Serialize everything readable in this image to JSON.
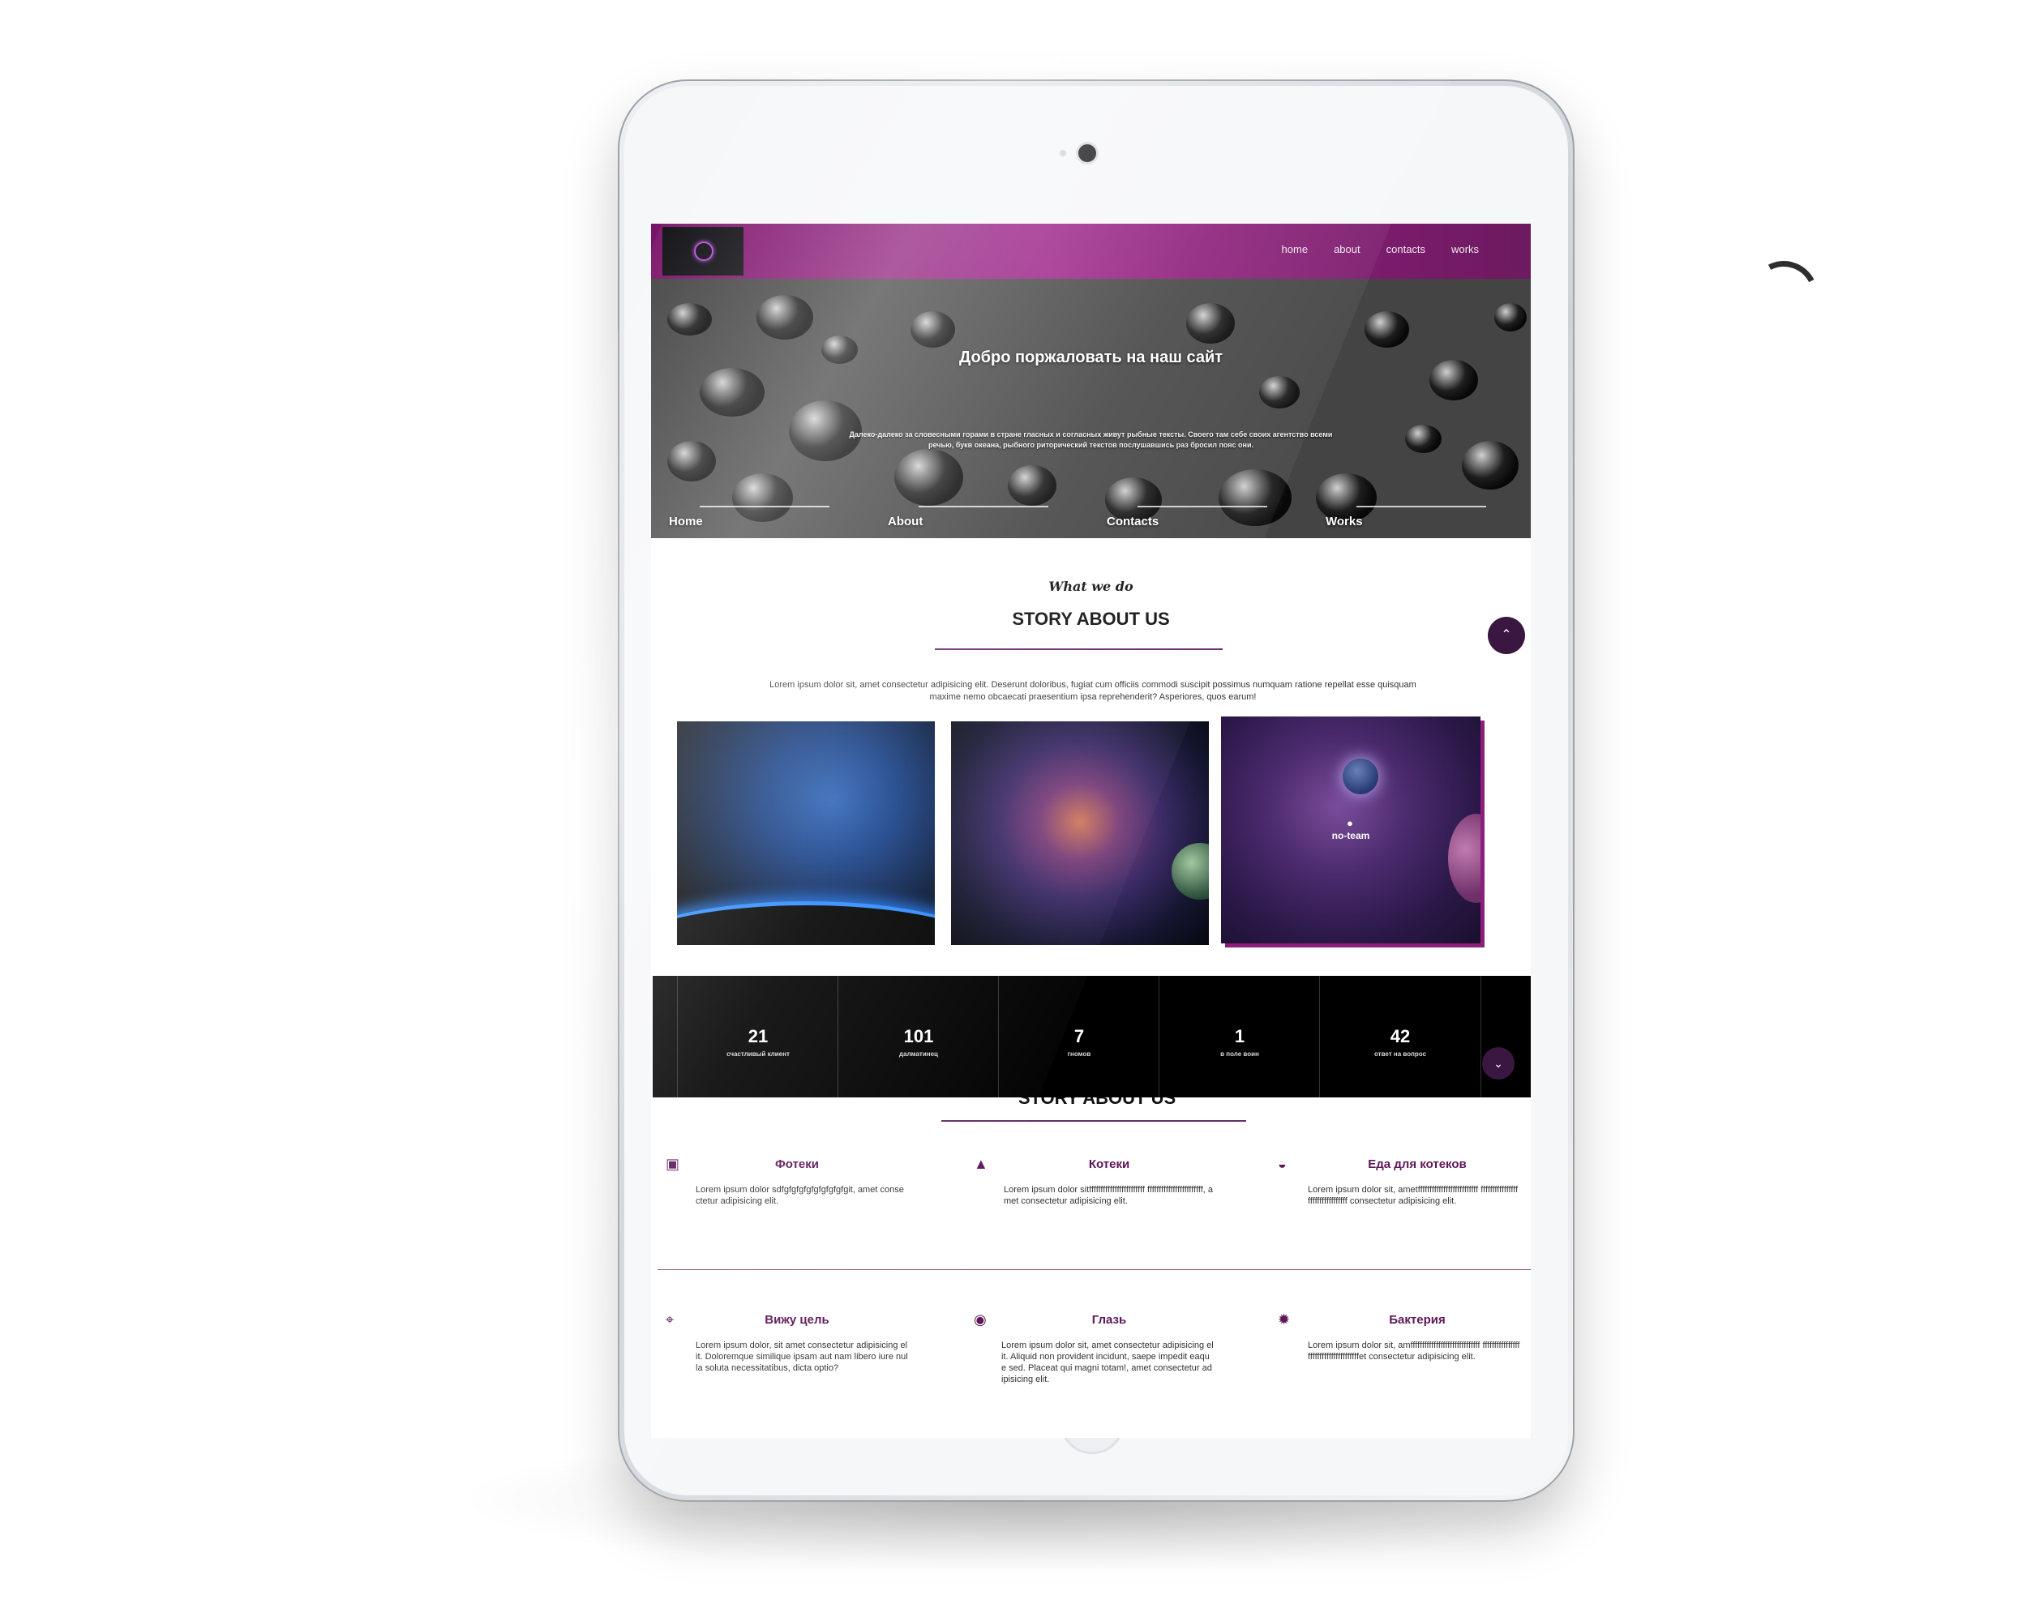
{
  "nav": {
    "links": [
      "home",
      "about",
      "contacts",
      "works"
    ]
  },
  "hero": {
    "title": "Добро поржаловать на наш сайт",
    "text": "Далеко-далеко за словесными горами в стране гласных и согласных живут рыбные тексты. Своего там себе своих агентство всеми речью, букв океана, рыбного риторический текстов послушавшись раз бросил пояс они.",
    "tabs": [
      "Home",
      "About",
      "Contacts",
      "Works"
    ]
  },
  "about": {
    "script": "What we do",
    "title": "STORY ABOUT US",
    "text": "Lorem ipsum dolor sit, amet consectetur adipisicing elit. Deserunt doloribus, fugiat cum officiis commodi suscipit possimus numquam ratione repellat esse quisquam maxime nemo obcaecati praesentium ipsa reprehenderit? Asperiores, quos earum!",
    "card_label": "no-team"
  },
  "stats": [
    {
      "num": "21",
      "label": "счастливый клиент"
    },
    {
      "num": "101",
      "label": "далматинец"
    },
    {
      "num": "7",
      "label": "гномов"
    },
    {
      "num": "1",
      "label": "в поле воин"
    },
    {
      "num": "42",
      "label": "ответ на вопрос"
    }
  ],
  "section2_title": "STORY ABOUT US",
  "features": [
    {
      "icon": "camera-icon",
      "title": "Фотеки",
      "text": "Lorem ipsum dolor sdfgfgfgfgfgfgfgfgfgit, amet consectetur adipisicing elit."
    },
    {
      "icon": "cat-icon",
      "title": "Котеки",
      "text": "Lorem ipsum dolor sitffffffffffffffffffffffff ffffffffffffffffffffffff, amet consectetur adipisicing elit."
    },
    {
      "icon": "bowl-icon",
      "title": "Еда для котеков",
      "text": "Lorem ipsum dolor sit, ametffffffffffffffffffffffffff fffffffffffffffffffffffffffffffff consectetur adipisicing elit."
    },
    {
      "icon": "crosshair-icon",
      "title": "Вижу цель",
      "text": "Lorem ipsum dolor, sit amet consectetur adipisicing elit. Doloremque similique ipsam aut nam libero iure nulla soluta necessitatibus, dicta optio?"
    },
    {
      "icon": "eye-icon",
      "title": "Глазь",
      "text": "Lorem ipsum dolor sit, amet consectetur adipisicing elit. Aliquid non provident incidunt, saepe impedit eaque sed. Placeat qui magni totam!, amet consectetur adipisicing elit."
    },
    {
      "icon": "bacteria-icon",
      "title": "Бактерия",
      "text": "Lorem ipsum dolor sit, amffffffffffffffffffffffffffffff ffffffffffffffffffffffffffffffffffffffet consectetur adipisicing elit."
    }
  ],
  "colors": {
    "accent": "#5e1658",
    "navbar": "#9b1f87",
    "stats_bg": "#000000"
  }
}
